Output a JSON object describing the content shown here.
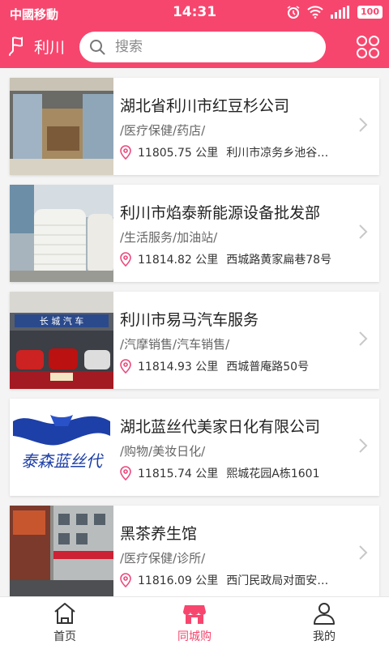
{
  "status_bar": {
    "carrier": "中國移動",
    "time": "14:31",
    "battery": "100"
  },
  "header": {
    "city": "利川",
    "search_placeholder": "搜索"
  },
  "colors": {
    "accent": "#f7466e"
  },
  "stores": [
    {
      "name": "湖北省利川市红豆杉公司",
      "category": "/医疗保健/药店/",
      "distance": "11805.75 公里",
      "address": "利川市凉务乡池谷…"
    },
    {
      "name": "利川市焰泰新能源设备批发部",
      "category": "/生活服务/加油站/",
      "distance": "11814.82 公里",
      "address": "西城路黄家扁巷78号"
    },
    {
      "name": "利川市易马汽车服务",
      "category": "/汽摩销售/汽车销售/",
      "distance": "11814.93 公里",
      "address": "西城普庵路50号"
    },
    {
      "name": "湖北蓝丝代美家日化有限公司",
      "category": "/购物/美妆日化/",
      "distance": "11815.74 公里",
      "address": "熙城花园A栋1601"
    },
    {
      "name": "黑茶养生馆",
      "category": "/医疗保健/诊所/",
      "distance": "11816.09 公里",
      "address": "西门民政局对面安…"
    }
  ],
  "thumb_text": {
    "car_shop_sign": "长 城 汽 车",
    "logo_text": "泰森蓝丝代"
  },
  "bottom_nav": [
    {
      "label": "首页",
      "icon": "home-icon"
    },
    {
      "label": "同城购",
      "icon": "shop-icon",
      "active": true
    },
    {
      "label": "我的",
      "icon": "user-icon"
    }
  ]
}
